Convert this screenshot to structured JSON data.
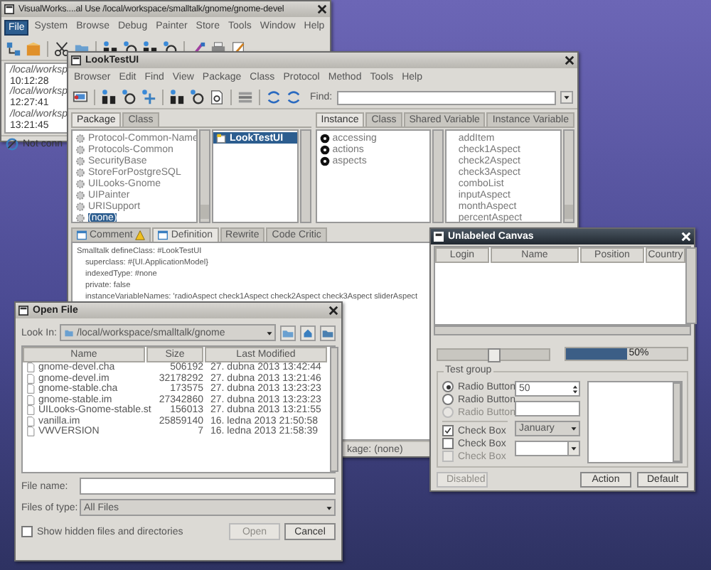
{
  "main_window": {
    "title": "VisualWorks....al Use /local/workspace/smalltalk/gnome/gnome-devel",
    "menu": [
      {
        "label": "File",
        "selected": true
      },
      {
        "label": "System",
        "selected": false
      },
      {
        "label": "Browse",
        "selected": false
      },
      {
        "label": "Debug",
        "selected": false
      },
      {
        "label": "Painter",
        "selected": false
      },
      {
        "label": "Store",
        "selected": false
      },
      {
        "label": "Tools",
        "selected": false
      },
      {
        "label": "Window",
        "selected": false
      },
      {
        "label": "Help",
        "selected": false
      }
    ],
    "log": [
      "/local/worksp",
      "10:12:28",
      "/local/worksp",
      "12:27:41",
      "/local/worksp",
      "13:21:45"
    ],
    "status": "Not conn"
  },
  "browser_window": {
    "title": "LookTestUI",
    "menu": [
      "Browser",
      "Edit",
      "Find",
      "View",
      "Package",
      "Class",
      "Protocol",
      "Method",
      "Tools",
      "Help"
    ],
    "find_label": "Find:",
    "left_tabs": [
      {
        "label": "Package",
        "selected": true
      },
      {
        "label": "Class",
        "selected": false
      }
    ],
    "right_tabs": [
      {
        "label": "Instance",
        "selected": true
      },
      {
        "label": "Class",
        "selected": false
      },
      {
        "label": "Shared Variable",
        "selected": false
      },
      {
        "label": "Instance Variable",
        "selected": false
      }
    ],
    "packages": [
      {
        "label": "Protocol-Common-Name",
        "selected": false
      },
      {
        "label": "Protocols-Common",
        "selected": false
      },
      {
        "label": "SecurityBase",
        "selected": false
      },
      {
        "label": "StoreForPostgreSQL",
        "selected": false
      },
      {
        "label": "UILooks-Gnome",
        "selected": false
      },
      {
        "label": "UIPainter",
        "selected": false
      },
      {
        "label": "URISupport",
        "selected": false
      },
      {
        "label": "(none)",
        "selected": true
      }
    ],
    "classes": [
      {
        "label": "LookTestUI",
        "selected": true
      }
    ],
    "protocols": [
      {
        "label": "accessing",
        "selected": false
      },
      {
        "label": "actions",
        "selected": false
      },
      {
        "label": "aspects",
        "selected": false
      }
    ],
    "methods": [
      {
        "label": "addItem",
        "selected": false
      },
      {
        "label": "check1Aspect",
        "selected": false
      },
      {
        "label": "check2Aspect",
        "selected": false
      },
      {
        "label": "check3Aspect",
        "selected": false
      },
      {
        "label": "comboList",
        "selected": false
      },
      {
        "label": "inputAspect",
        "selected": false
      },
      {
        "label": "monthAspect",
        "selected": false
      },
      {
        "label": "percentAspect",
        "selected": false
      }
    ],
    "code_tabs": [
      {
        "label": "Comment",
        "kind": "page-warning",
        "selected": false
      },
      {
        "label": "Definition",
        "kind": "page",
        "selected": true
      },
      {
        "label": "Rewrite",
        "kind": "plain",
        "selected": false
      },
      {
        "label": "Code Critic",
        "kind": "plain",
        "selected": false
      }
    ],
    "code": [
      {
        "text": "Smalltalk defineClass: #LookTestUI",
        "kind": "head"
      },
      {
        "text": "superclass: #{UI.ApplicationModel}",
        "kind": "indent"
      },
      {
        "text": "indexedType: #none",
        "kind": "indent"
      },
      {
        "text": "private: false",
        "kind": "indent"
      },
      {
        "text": "instanceVariableNames: 'radioAspect check1Aspect check2Aspect check3Aspect sliderAspect",
        "kind": "indent"
      }
    ],
    "status": "kage: (none)"
  },
  "canvas_window": {
    "title": "Unlabeled Canvas",
    "columns": [
      "Login",
      "Name",
      "Position",
      "Country"
    ],
    "slider": {
      "level": 0.5
    },
    "progress": {
      "level": 0.5,
      "reading": "50%"
    },
    "group_title": "Test group",
    "radios": [
      {
        "label": "Radio Button",
        "selected": true,
        "disabled": false
      },
      {
        "label": "Radio Button",
        "selected": false,
        "disabled": false
      },
      {
        "label": "Radio Button",
        "selected": false,
        "disabled": true
      }
    ],
    "checks": [
      {
        "label": "Check Box",
        "checked": true,
        "disabled": false
      },
      {
        "label": "Check Box",
        "checked": false,
        "disabled": false
      },
      {
        "label": "Check Box",
        "checked": false,
        "disabled": true
      }
    ],
    "spinner": "50",
    "combo": "January",
    "buttons": [
      {
        "label": "Disabled",
        "disabled": true
      },
      {
        "label": "Action",
        "disabled": false
      },
      {
        "label": "Default",
        "disabled": false
      }
    ]
  },
  "open_dialog": {
    "title": "Open File",
    "look_in_label": "Look In:",
    "path": "/local/workspace/smalltalk/gnome",
    "columns": [
      "Name",
      "Size",
      "Last Modified"
    ],
    "files": [
      {
        "name": "gnome-devel.cha",
        "size": "506192",
        "modified": "27. dubna 2013 13:42:44"
      },
      {
        "name": "gnome-devel.im",
        "size": "32178292",
        "modified": "27. dubna 2013 13:21:46"
      },
      {
        "name": "gnome-stable.cha",
        "size": "173575",
        "modified": "27. dubna 2013 13:23:23"
      },
      {
        "name": "gnome-stable.im",
        "size": "27342860",
        "modified": "27. dubna 2013 13:23:23"
      },
      {
        "name": "UILooks-Gnome-stable.st",
        "size": "156013",
        "modified": "27. dubna 2013 13:21:55"
      },
      {
        "name": "vanilla.im",
        "size": "25859140",
        "modified": "16. ledna 2013 21:50:58"
      },
      {
        "name": "VWVERSION",
        "size": "7",
        "modified": "16. ledna 2013 21:58:39"
      }
    ],
    "file_name_label": "File name:",
    "file_type_label": "Files of type:",
    "file_type": "All Files",
    "show_hidden": {
      "label": "Show hidden files and directories",
      "checked": false
    },
    "buttons": [
      {
        "label": "Open",
        "disabled": true
      },
      {
        "label": "Cancel",
        "disabled": false
      }
    ]
  }
}
